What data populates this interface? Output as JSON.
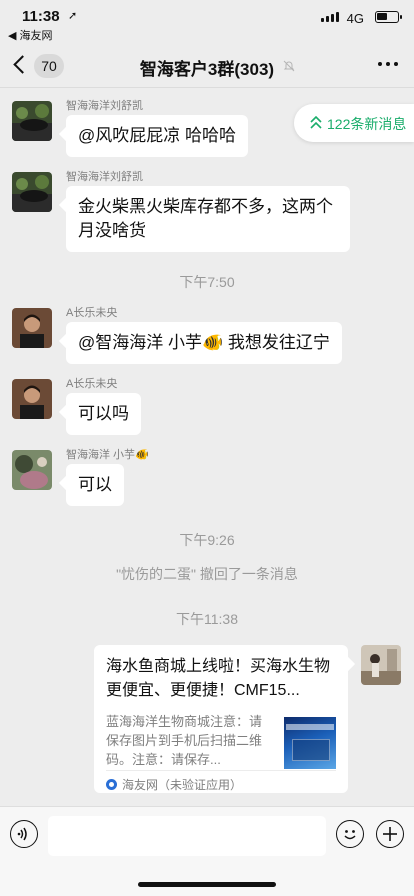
{
  "status_bar": {
    "time": "11:38",
    "back_app": "◀ 海友网",
    "network": "4G",
    "battery_level": 0.55
  },
  "nav": {
    "back_count": "70",
    "title": "智海客户3群(303)"
  },
  "new_messages": {
    "label": "122条新消息",
    "color": "#1aad6b"
  },
  "messages": [
    {
      "sender": "智海海洋刘舒凯",
      "text": "@风吹屁屁凉 哈哈哈"
    },
    {
      "sender": "智海海洋刘舒凯",
      "text": "金火柴黑火柴库存都不多，这两个月没啥货"
    },
    {
      "sender": "A长乐未央",
      "text": "@智海海洋 小芋🐠 我想发往辽宁"
    },
    {
      "sender": "A长乐未央",
      "text": "可以吗"
    },
    {
      "sender": "智海海洋 小芋🐠",
      "text": "可以"
    }
  ],
  "system": {
    "time1": "下午7:50",
    "time2": "下午9:26",
    "recall": "\"忧伤的二蛋\" 撤回了一条消息",
    "time3": "下午11:38"
  },
  "link_card": {
    "title": "海水鱼商城上线啦！买海水生物更便宜、更便捷！CMF15...",
    "description": "蓝海海洋生物商城注意：请保存图片到手机后扫描二维码。注意：请保存...",
    "source": "海友网（未验证应用）"
  }
}
